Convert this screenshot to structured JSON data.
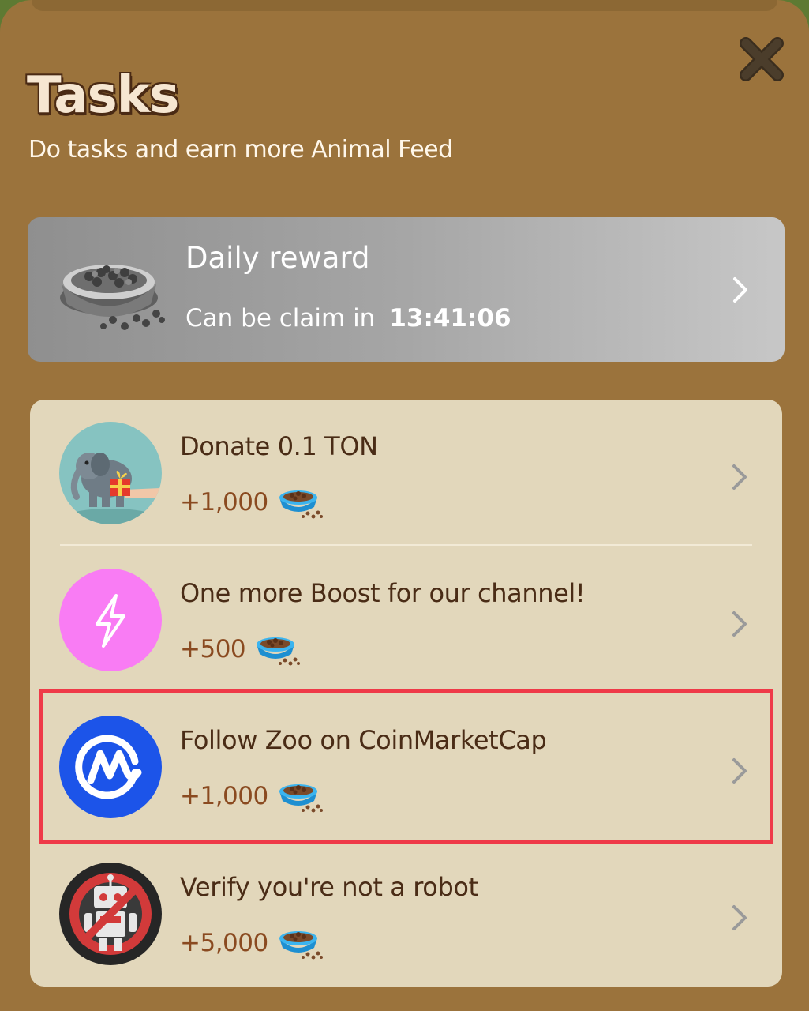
{
  "header": {
    "title": "Tasks",
    "subtitle": "Do tasks and earn more Animal Feed"
  },
  "daily_reward": {
    "title": "Daily reward",
    "claim_label": "Can be claim in",
    "countdown": "13:41:06",
    "icon": "feed-bowl-icon"
  },
  "tasks": [
    {
      "title": "Donate 0.1 TON",
      "reward": "+1,000",
      "icon": "elephant-gift-icon"
    },
    {
      "title": "One more Boost for our channel!",
      "reward": "+500",
      "icon": "lightning-boost-icon"
    },
    {
      "title": "Follow Zoo on CoinMarketCap",
      "reward": "+1,000",
      "icon": "coinmarketcap-icon"
    },
    {
      "title": "Verify you're not a robot",
      "reward": "+5,000",
      "icon": "no-robot-icon"
    }
  ],
  "colors": {
    "modal_bg": "#9b733c",
    "list_bg": "#e2d7bb",
    "title_text": "#f6e6d1",
    "task_text": "#4a2c16",
    "reward_text": "#8a4a20",
    "highlight": "#ef3a48",
    "boost_icon_bg": "#f97cf4",
    "cmc_icon_bg": "#1c54e9"
  }
}
